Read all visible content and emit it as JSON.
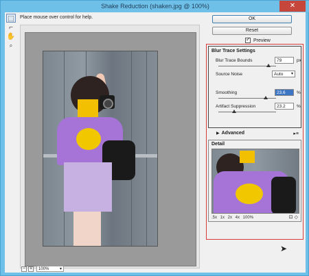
{
  "window": {
    "title": "Shake Reduction (shaken.jpg @ 100%)",
    "close_label": "✕"
  },
  "toolbar": {
    "help_text": "Place mouse over control for help."
  },
  "tools": [
    {
      "name": "marquee-tool-icon",
      "glyph": "⬚"
    },
    {
      "name": "brush-tool-icon",
      "glyph": "⌐"
    },
    {
      "name": "hand-tool-icon",
      "glyph": "✋"
    },
    {
      "name": "zoom-tool-icon",
      "glyph": "🔍"
    }
  ],
  "zoom": {
    "minus": "−",
    "plus": "+",
    "value": "100%"
  },
  "buttons": {
    "ok": "OK",
    "reset": "Reset"
  },
  "preview": {
    "label": "Preview",
    "checked": true
  },
  "blur_trace": {
    "title": "Blur Trace Settings",
    "bounds_label": "Blur Trace Bounds",
    "bounds_value": "79",
    "bounds_unit": "px",
    "noise_label": "Source Noise",
    "noise_value": "Auto",
    "smoothing_label": "Smoothing",
    "smoothing_value": "23.6",
    "smoothing_unit": "%",
    "artifact_label": "Artifact Suppression",
    "artifact_value": "23.2",
    "artifact_unit": "%"
  },
  "advanced": {
    "label": "Advanced",
    "menu": "▸≡"
  },
  "detail": {
    "label": "Detail",
    "zooms": ".5x  1x  2x  4x  100%",
    "icons": "⊡ ◇"
  },
  "colors": {
    "highlight": "#d83a3a",
    "titlebar": "#6fc0e8"
  }
}
